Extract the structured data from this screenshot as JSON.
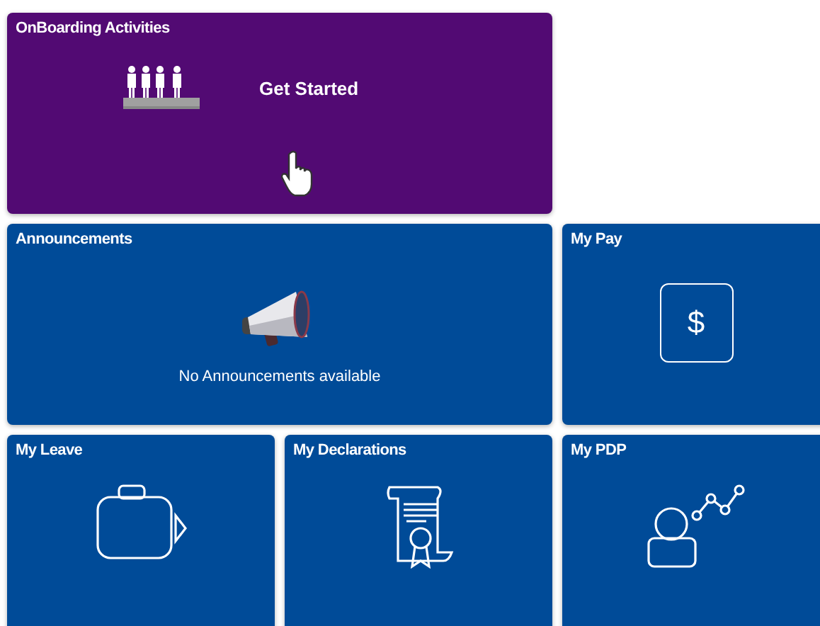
{
  "tiles": [
    {
      "kind": "onboarding",
      "title": "OnBoarding Activities",
      "action": "Get Started"
    },
    {
      "kind": "announcements",
      "title": "Announcements",
      "message": "No Announcements available"
    },
    {
      "kind": "pay",
      "title": "My Pay",
      "symbol": "$"
    },
    {
      "kind": "leave",
      "title": "My Leave"
    },
    {
      "kind": "declarations",
      "title": "My Declarations"
    },
    {
      "kind": "pdp",
      "title": "My PDP"
    }
  ]
}
